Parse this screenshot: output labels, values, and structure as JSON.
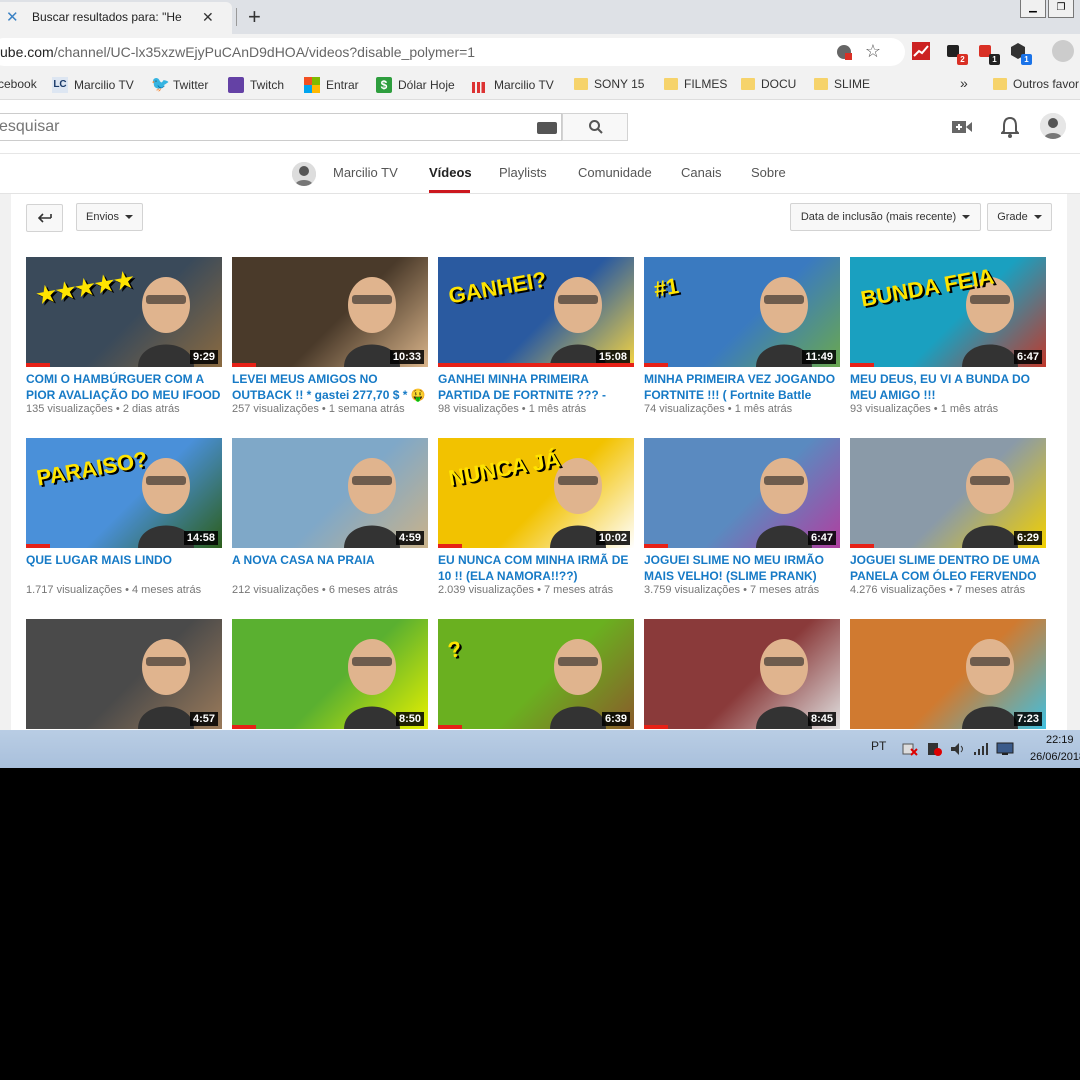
{
  "browser": {
    "tab_title": "Buscar resultados para: \"Hellboy\"",
    "url_prefix": "ube.com",
    "url_rest": "/channel/UC-lx35xzwEjyPuCAnD9dHOA/videos?disable_polymer=1",
    "extensions": [
      {
        "name": "chart-extension",
        "color": "#cc2222",
        "badge": ""
      },
      {
        "name": "extension-2",
        "color": "#222222",
        "badge": "2",
        "badge_color": "#d93025"
      },
      {
        "name": "extension-1",
        "color": "#d93025",
        "badge": "1",
        "badge_color": "#222222"
      },
      {
        "name": "extension-3",
        "color": "#333333",
        "badge": "1",
        "badge_color": "#1a73e8"
      }
    ]
  },
  "bookmarks": [
    {
      "label": "cebook",
      "icon": "facebook-icon"
    },
    {
      "label": "Marcilio TV",
      "icon": "lc-icon"
    },
    {
      "label": "Twitter",
      "icon": "twitter-icon"
    },
    {
      "label": "Twitch",
      "icon": "twitch-icon"
    },
    {
      "label": "Entrar",
      "icon": "microsoft-icon"
    },
    {
      "label": "Dólar Hoje",
      "icon": "dollar-icon"
    },
    {
      "label": "Marcilio TV",
      "icon": "chart-icon"
    },
    {
      "label": "SONY 15",
      "icon": "folder-icon"
    },
    {
      "label": "FILMES",
      "icon": "folder-icon"
    },
    {
      "label": "DOCU",
      "icon": "folder-icon"
    },
    {
      "label": "SLIME",
      "icon": "folder-icon"
    },
    {
      "label": "»",
      "icon": "overflow-icon"
    },
    {
      "label": "Outros favor",
      "icon": "folder-icon"
    }
  ],
  "youtube": {
    "search_placeholder": "esquisar"
  },
  "channel_tabs": [
    {
      "label": "Marcilio TV",
      "active": false
    },
    {
      "label": "Vídeos",
      "active": true
    },
    {
      "label": "Playlists",
      "active": false
    },
    {
      "label": "Comunidade",
      "active": false
    },
    {
      "label": "Canais",
      "active": false
    },
    {
      "label": "Sobre",
      "active": false
    }
  ],
  "toolbar": {
    "back_icon": "back-arrow-icon",
    "uploads_label": "Envios",
    "sort_label": "Data de inclusão (mais recente)",
    "view_label": "Grade"
  },
  "videos": [
    {
      "title": "COMI O HAMBÚRGUER COM A PIOR AVALIAÇÃO DO MEU IFOOD",
      "views": "135 visualizações",
      "age": "2 dias atrás",
      "duration": "9:29",
      "progress": 0.12,
      "bg": "#3a4a5a",
      "accent": "#8a6a40",
      "overlay": "★★★★★"
    },
    {
      "title": "LEVEI MEUS AMIGOS NO OUTBACK !! * gastei 277,70 $ * 🤑",
      "views": "257 visualizações",
      "age": "1 semana atrás",
      "duration": "10:33",
      "progress": 0.12,
      "bg": "#4a3a2a",
      "accent": "#d9b48a",
      "overlay": ""
    },
    {
      "title": "GANHEI MINHA PRIMEIRA PARTIDA DE FORTNITE ??? - (Fortnite Battle Royale)",
      "views": "98 visualizações",
      "age": "1 mês atrás",
      "duration": "15:08",
      "progress": 1.0,
      "bg": "#2a5aa0",
      "accent": "#f5d442",
      "overlay": "GANHEI?"
    },
    {
      "title": "MINHA PRIMEIRA VEZ JOGANDO FORTNITE !!! ( Fortnite Battle Royale)",
      "views": "74 visualizações",
      "age": "1 mês atrás",
      "duration": "11:49",
      "progress": 0.12,
      "bg": "#3a7ac0",
      "accent": "#6aa84f",
      "overlay": "#1"
    },
    {
      "title": "MEU DEUS, EU VI A BUNDA DO MEU AMIGO !!!",
      "views": "93 visualizações",
      "age": "1 mês atrás",
      "duration": "6:47",
      "progress": 0.12,
      "bg": "#1aa0c0",
      "accent": "#c0392b",
      "overlay": "BUNDA FEIA"
    },
    {
      "title": "QUE LUGAR MAIS LINDO",
      "views": "1.717 visualizações",
      "age": "4 meses atrás",
      "duration": "14:58",
      "progress": 0.12,
      "bg": "#4a90d9",
      "accent": "#2c5e1a",
      "overlay": "PARAISO?"
    },
    {
      "title": "A NOVA CASA NA PRAIA",
      "views": "212 visualizações",
      "age": "6 meses atrás",
      "duration": "4:59",
      "progress": 0.0,
      "bg": "#7fa8c8",
      "accent": "#c9b28a",
      "overlay": ""
    },
    {
      "title": "EU NUNCA COM MINHA IRMÃ DE 10 !! (ELA NAMORA!!??)",
      "views": "2.039 visualizações",
      "age": "7 meses atrás",
      "duration": "10:02",
      "progress": 0.12,
      "bg": "#f2c200",
      "accent": "#ffffff",
      "overlay": "NUNCA  JÁ"
    },
    {
      "title": "JOGUEI SLIME NO MEU IRMÃO MAIS VELHO! (SLIME PRANK) [CONTEÚDO SENSÍVEL]",
      "views": "3.759 visualizações",
      "age": "7 meses atrás",
      "duration": "6:47",
      "progress": 0.12,
      "bg": "#5a8ac0",
      "accent": "#b03fa0",
      "overlay": ""
    },
    {
      "title": "JOGUEI SLIME DENTRO DE UMA PANELA COM ÓLEO FERVENDO !!!",
      "views": "4.276 visualizações",
      "age": "7 meses atrás",
      "duration": "6:29",
      "progress": 0.12,
      "bg": "#8a9aa8",
      "accent": "#f2d000",
      "overlay": ""
    },
    {
      "title": "",
      "views": "",
      "age": "",
      "duration": "4:57",
      "progress": 0.0,
      "bg": "#4a4a4a",
      "accent": "#9a7a5a",
      "overlay": ""
    },
    {
      "title": "",
      "views": "",
      "age": "",
      "duration": "8:50",
      "progress": 0.12,
      "bg": "#5ab030",
      "accent": "#e6f000",
      "overlay": ""
    },
    {
      "title": "",
      "views": "",
      "age": "",
      "duration": "6:39",
      "progress": 0.12,
      "bg": "#6ab020",
      "accent": "#8a5a2a",
      "overlay": "?"
    },
    {
      "title": "",
      "views": "",
      "age": "",
      "duration": "8:45",
      "progress": 0.12,
      "bg": "#8a3a3a",
      "accent": "#e0e0e0",
      "overlay": ""
    },
    {
      "title": "",
      "views": "",
      "age": "",
      "duration": "7:23",
      "progress": 0.0,
      "bg": "#d07a30",
      "accent": "#40c0e0",
      "overlay": ""
    }
  ],
  "taskbar": {
    "lang": "PT",
    "time": "22:19",
    "date": "26/06/2018"
  }
}
